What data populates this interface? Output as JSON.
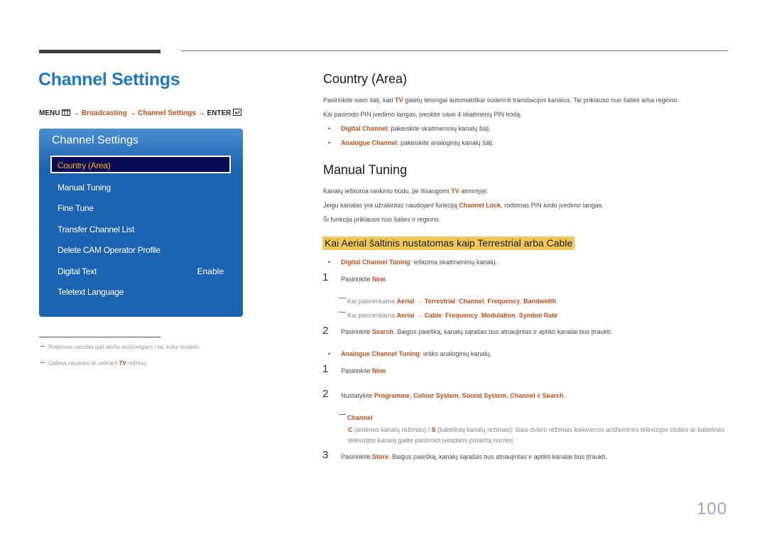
{
  "page_title": "Channel Settings",
  "menu_path": {
    "menu": "MENU",
    "arrow": "→",
    "step1": "Broadcasting",
    "step2": "Channel Settings",
    "enter": "ENTER"
  },
  "panel": {
    "title": "Channel Settings",
    "items": [
      {
        "label": "Country (Area)",
        "selected": true
      },
      {
        "label": "Manual Tuning"
      },
      {
        "label": "Fine Tune"
      },
      {
        "label": "Transfer Channel List"
      },
      {
        "label": "Delete CAM Operator Profile"
      },
      {
        "label": "Digital Text",
        "value": "Enable"
      },
      {
        "label": "Teletext Language"
      }
    ]
  },
  "footnotes": [
    {
      "text": "Rodomas vaizdas gali skirtis atsižvelgiant į tai, koks modelis."
    },
    {
      "pre": "Galima naudotis tik veikiant ",
      "hl": "TV",
      "post": " režimui."
    }
  ],
  "country": {
    "heading": "Country (Area)",
    "p1_pre": "Pasirinkite savo šalį, kad ",
    "p1_hl": "TV",
    "p1_post": " galėtų teisingai automatiškai suderinti transliacijos kanalus. Tai priklauso nuo šalies arba regiono.",
    "p2": "Kai pasirodo PIN įvedimo langas, įveskite savo 4 skaitmenų PIN kodą.",
    "bullets": [
      {
        "hl": "Digital Channel",
        "text": ": pakeiskite skaitmeninių kanalų šalį."
      },
      {
        "hl": "Analogue Channel",
        "text": ": pakeiskite analoginių kanalų šalį."
      }
    ]
  },
  "manual": {
    "heading": "Manual Tuning",
    "p1_pre": "Kanalų ieškoma rankiniu būdu, jie išsaugomi ",
    "p1_hl": "TV",
    "p1_post": " atmintyje.",
    "p2_pre": "Jeigu kanalas yra užrakintas naudojant funkciją ",
    "p2_hl": "Channel Lock",
    "p2_post": ", rodomas PIN kodo įvedimo langas.",
    "p3": "Ši funkcija priklauso nuo šalies ir regiono.",
    "subheading": "Kai Aerial šaltinis nustatomas kaip Terrestrial arba Cable",
    "digital": {
      "hl": "Digital Channel Tuning",
      "text": ": ieškoma skaitmeninių kanalų.",
      "step1_num": "1",
      "step1_pre": "Pasirinkite ",
      "step1_hl": "New",
      "step1_post": ".",
      "note1_pre": "Kai pasirenkama ",
      "note1_a": "Aerial",
      "note1_arrow": " → ",
      "note1_b": "Terrestrial",
      "note1_sep": ": ",
      "note1_c": "Channel",
      "note1_d": "Frequency",
      "note1_e": "Bandwidth",
      "note2_pre": "Kai pasirenkama ",
      "note2_a": "Aerial",
      "note2_arrow": " → ",
      "note2_b": "Cable",
      "note2_sep": ": ",
      "note2_c": "Frequency",
      "note2_d": "Modulation",
      "note2_e": "Symbol Rate",
      "comma": ", ",
      "step2_num": "2",
      "step2_pre": "Pasirinkite ",
      "step2_hl": "Search",
      "step2_post": ". Baigus paiešką, kanalų sąrašas bus atnaujintas ir aptikti kanalai bus įtraukti."
    },
    "analogue": {
      "hl": "Analogue Channel Tuning",
      "text": ": ieško analoginių kanalų.",
      "step1_num": "1",
      "step1_pre": "Pasirinkite ",
      "step1_hl": "New",
      "step1_post": ".",
      "step2_num": "2",
      "step2_pre": "Nustatykite ",
      "step2_a": "Programme",
      "step2_b": "Colour System",
      "step2_c": "Sound System",
      "step2_d": "Channel",
      "step2_ir": " ir ",
      "step2_e": "Search",
      "step2_post": ".",
      "note_title": "Channel",
      "note_c": "C",
      "note_c_text": " (antenos kanalų režimas) / ",
      "note_s": "S",
      "note_s_text": " (kabelinių kanalų režimas): šiais dviem režimais kiekvienos antžeminės televizijos stoties ar kabelinės televizijos kanalą galite pasirinkti įvesdami priskirtą numerį.",
      "step3_num": "3",
      "step3_pre": "Pasirinkite ",
      "step3_hl": "Store",
      "step3_post": ". Baigus paiešką, kanalų sąrašas bus atnaujintas ir aptikti kanalai bus įtraukti."
    }
  },
  "page_number": "100",
  "colors": {
    "title_blue": "#1e7ac8",
    "highlight_orange": "#c0511f",
    "panel_blue": "#1c63b1",
    "selected_bg": "#090b55",
    "selected_text": "#f0b427",
    "subheading_bg": "#f0c85a"
  }
}
